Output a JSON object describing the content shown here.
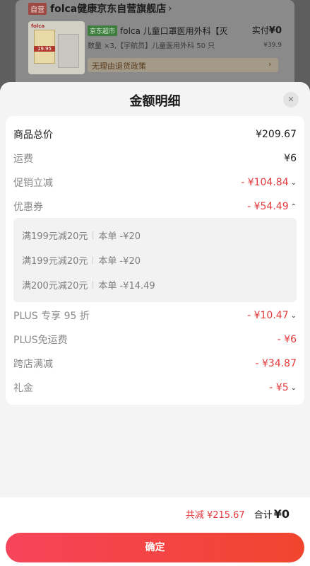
{
  "order_preview": {
    "self_badge": "自营",
    "store_name": "folca健康京东自营旗舰店",
    "store_arrow": "›",
    "thumb_logo": "folca",
    "thumb_tag": "19.95",
    "jd_badge": "京东超市",
    "product_title": "folca 儿童口罩医用外科【灭",
    "paid_label": "实付",
    "paid_value": "¥0",
    "product_meta": "数量 ×3,【宇航员】儿童医用外科 50 只",
    "original_price": "¥39.9",
    "return_policy": "无理由退货政策",
    "policy_arrow": "›"
  },
  "sheet": {
    "title": "金额明细",
    "close_icon": "✕"
  },
  "rows": {
    "subtotal": {
      "label": "商品总价",
      "value": "¥209.67"
    },
    "shipping": {
      "label": "运费",
      "value": "¥6"
    },
    "promo": {
      "label": "促销立减",
      "value": "- ¥104.84",
      "chevron": "⌄"
    },
    "coupon": {
      "label": "优惠券",
      "value": "- ¥54.49",
      "chevron": "⌃"
    },
    "plus_discount": {
      "label": "PLUS 专享 95 折",
      "value": "- ¥10.47",
      "chevron": "⌄"
    },
    "plus_shipping": {
      "label": "PLUS免运费",
      "value": "- ¥6"
    },
    "cross_store": {
      "label": "跨店满减",
      "value": "- ¥34.87"
    },
    "gift": {
      "label": "礼金",
      "value": "- ¥5",
      "chevron": "⌄"
    }
  },
  "coupons": [
    {
      "name": "满199元减20元",
      "detail": "本单 -¥20"
    },
    {
      "name": "满199元减20元",
      "detail": "本单 -¥20"
    },
    {
      "name": "满200元减20元",
      "detail": "本单 -¥14.49"
    }
  ],
  "footer": {
    "saved": "共减 ¥215.67",
    "total_label": "合计",
    "total_value": "¥0",
    "confirm_label": "确定"
  },
  "colors": {
    "accent_red": "#e4393c",
    "confirm_gradient_start": "#f6445a",
    "confirm_gradient_end": "#f1452f"
  }
}
